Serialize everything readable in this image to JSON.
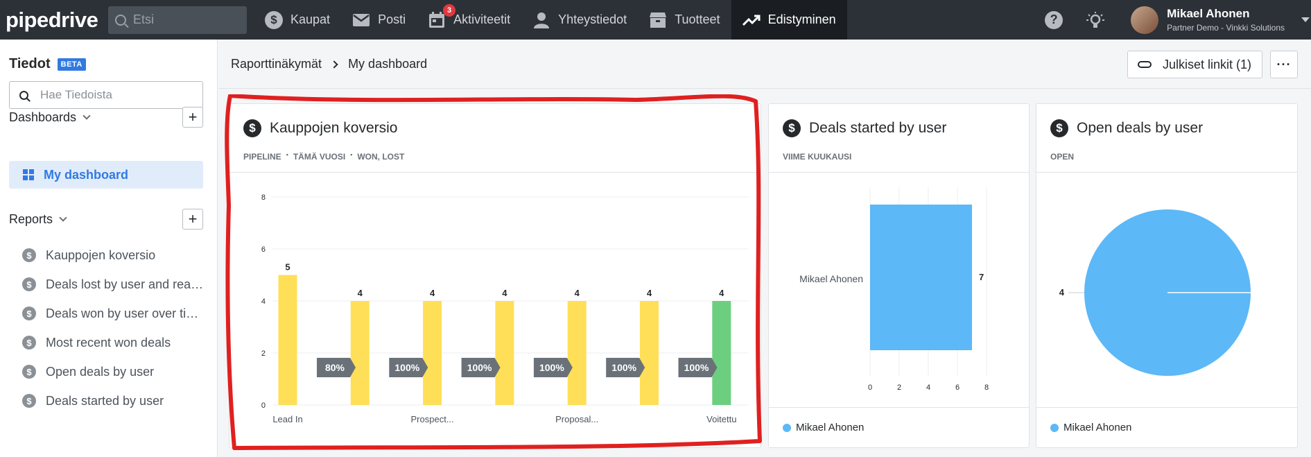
{
  "topnav": {
    "logo": "pipedrive",
    "search_placeholder": "Etsi",
    "items": [
      {
        "label": "Kaupat",
        "icon": "dollar-icon"
      },
      {
        "label": "Posti",
        "icon": "mail-icon"
      },
      {
        "label": "Aktiviteetit",
        "icon": "calendar-icon",
        "badge": "3"
      },
      {
        "label": "Yhteystiedot",
        "icon": "person-icon"
      },
      {
        "label": "Tuotteet",
        "icon": "box-icon"
      },
      {
        "label": "Edistyminen",
        "icon": "trend-icon",
        "active": true
      }
    ],
    "help_icon": "?",
    "user": {
      "name": "Mikael Ahonen",
      "org": "Partner Demo - Vinkki Solutions"
    }
  },
  "sidebar": {
    "title": "Tiedot",
    "beta": "BETA",
    "search_placeholder": "Hae Tiedoista",
    "dashboards_label": "Dashboards",
    "dashboard_item": "My dashboard",
    "reports_label": "Reports",
    "plus": "+",
    "reports": [
      "Kauppojen koversio",
      "Deals lost by user and rea…",
      "Deals won by user over ti…",
      "Most recent won deals",
      "Open deals by user",
      "Deals started by user"
    ]
  },
  "header": {
    "breadcrumb_root": "Raporttinäkymät",
    "breadcrumb_current": "My dashboard",
    "public_links": "Julkiset linkit (1)",
    "more": "···"
  },
  "cards": {
    "conversion": {
      "title": "Kauppojen koversio",
      "filters": [
        "PIPELINE",
        "TÄMÄ VUOSI",
        "WON, LOST"
      ]
    },
    "started": {
      "title": "Deals started by user",
      "filters": [
        "VIIME KUUKAUSI"
      ],
      "legend": "Mikael Ahonen"
    },
    "open": {
      "title": "Open deals by user",
      "filters": [
        "OPEN"
      ],
      "legend": "Mikael Ahonen"
    }
  },
  "chart_data": [
    {
      "type": "bar",
      "title": "Kauppojen koversio",
      "categories": [
        "Lead In",
        "",
        "Prospect...",
        "",
        "Proposal...",
        "",
        "Voitettu"
      ],
      "values": [
        5,
        4,
        4,
        4,
        4,
        4,
        4
      ],
      "conversion_rates": [
        "80%",
        "100%",
        "100%",
        "100%",
        "100%",
        "100%"
      ],
      "ylim": [
        0,
        8
      ],
      "yticks": [
        0,
        2,
        4,
        6,
        8
      ],
      "colors": {
        "stage": "#ffdf57",
        "won": "#6ccf7f",
        "arrow": "#6a7178"
      },
      "grid": true
    },
    {
      "type": "bar",
      "orientation": "horizontal",
      "title": "Deals started by user",
      "categories": [
        "Mikael Ahonen"
      ],
      "values": [
        7
      ],
      "xlim": [
        0,
        8
      ],
      "xticks": [
        0,
        2,
        4,
        6,
        8
      ],
      "color": "#5cb8f6",
      "legend": "bottom-left"
    },
    {
      "type": "pie",
      "title": "Open deals by user",
      "labels": [
        "Mikael Ahonen"
      ],
      "values": [
        4
      ],
      "color": "#5cb8f6",
      "legend": "bottom-left"
    }
  ]
}
